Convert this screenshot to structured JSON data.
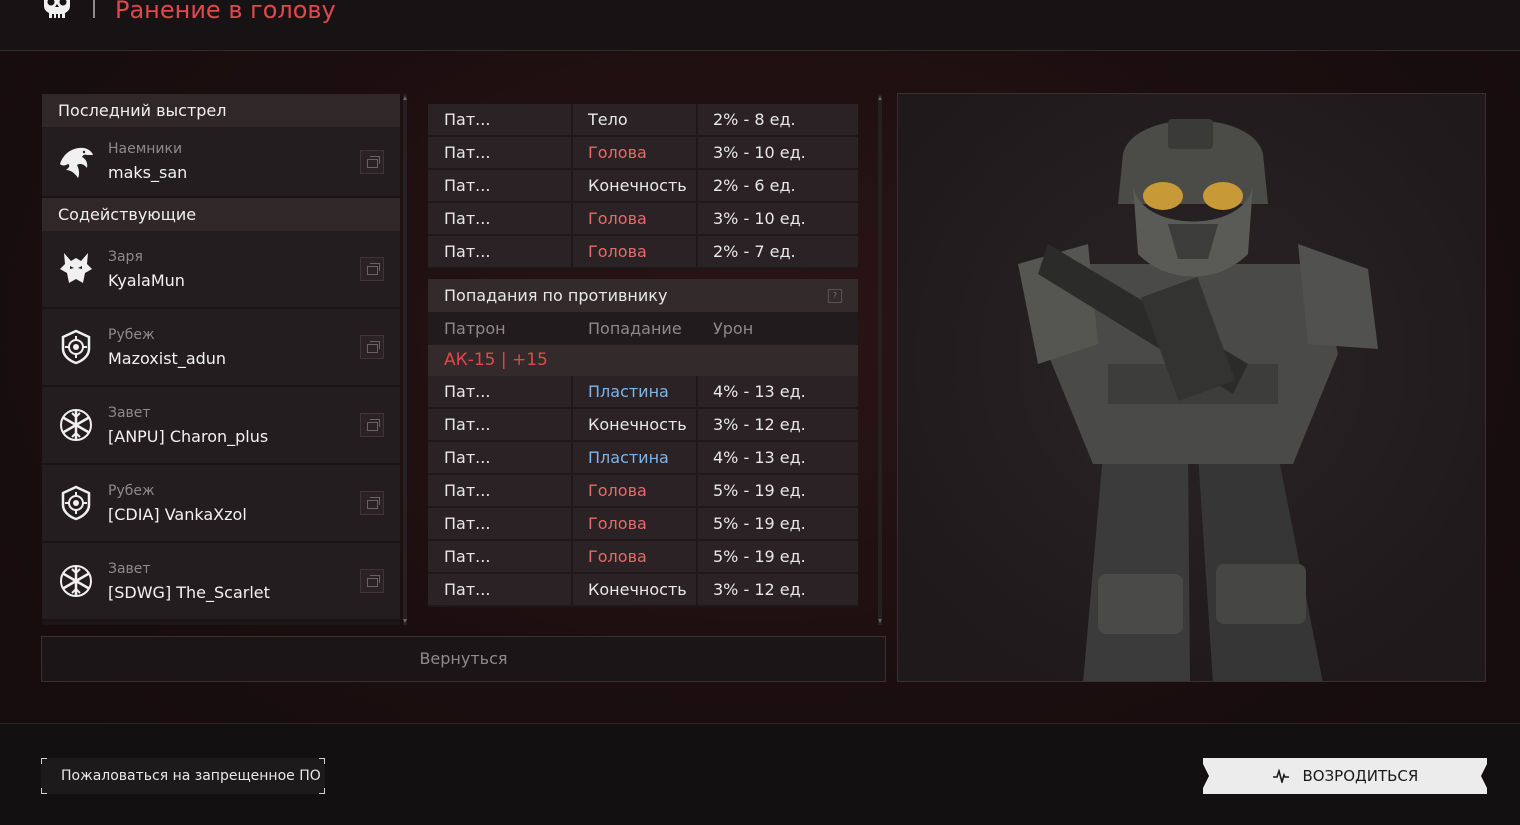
{
  "header": {
    "title": "Ранение в голову",
    "skull_icon": "skull-icon"
  },
  "colors": {
    "accent_red": "#e2474b",
    "blue_text": "#7db6ea",
    "red_text": "#e56b6b"
  },
  "killer_panel": {
    "last_shot_title": "Последний выстрел",
    "killer": {
      "faction": "Наемники",
      "name": "maks_san",
      "icon": "eagle-icon"
    },
    "assist_title": "Содействующие",
    "assists": [
      {
        "faction": "Заря",
        "name": "KyalaMun",
        "icon": "wolf-icon"
      },
      {
        "faction": "Рубеж",
        "name": "Mazoxist_adun",
        "icon": "shield-target-icon"
      },
      {
        "faction": "Завет",
        "name": "[ANPU] Charon_plus",
        "icon": "snowflake-emblem-icon"
      },
      {
        "faction": "Рубеж",
        "name": "[CDIA] VankaXzol",
        "icon": "shield-target-icon"
      },
      {
        "faction": "Завет",
        "name": "[SDWG] The_Scarlet",
        "icon": "snowflake-emblem-icon"
      }
    ]
  },
  "damage_taken": {
    "rows": [
      {
        "ammo": "Пат...",
        "hit": "Тело",
        "hit_color": "white",
        "damage": "2% - 8 ед."
      },
      {
        "ammo": "Пат...",
        "hit": "Голова",
        "hit_color": "red",
        "damage": "3% - 10 ед."
      },
      {
        "ammo": "Пат...",
        "hit": "Конечность",
        "hit_color": "white",
        "damage": "2% - 6 ед."
      },
      {
        "ammo": "Пат...",
        "hit": "Голова",
        "hit_color": "red",
        "damage": "3% - 10 ед."
      },
      {
        "ammo": "Пат...",
        "hit": "Голова",
        "hit_color": "red",
        "damage": "2% - 7 ед."
      }
    ]
  },
  "hits_on_enemy": {
    "title": "Попадания по противнику",
    "help": "?",
    "columns": [
      "Патрон",
      "Попадание",
      "Урон"
    ],
    "weapon": "АК-15 | +15",
    "rows": [
      {
        "ammo": "Пат...",
        "hit": "Пластина",
        "hit_color": "blue",
        "damage": "4% - 13 ед."
      },
      {
        "ammo": "Пат...",
        "hit": "Конечность",
        "hit_color": "white",
        "damage": "3% - 12 ед."
      },
      {
        "ammo": "Пат...",
        "hit": "Пластина",
        "hit_color": "blue",
        "damage": "4% - 13 ед."
      },
      {
        "ammo": "Пат...",
        "hit": "Голова",
        "hit_color": "red",
        "damage": "5% - 19 ед."
      },
      {
        "ammo": "Пат...",
        "hit": "Голова",
        "hit_color": "red",
        "damage": "5% - 19 ед."
      },
      {
        "ammo": "Пат...",
        "hit": "Голова",
        "hit_color": "red",
        "damage": "5% - 19 ед."
      },
      {
        "ammo": "Пат...",
        "hit": "Конечность",
        "hit_color": "white",
        "damage": "3% - 12 ед."
      }
    ]
  },
  "buttons": {
    "back": "Вернуться",
    "report": "Пожаловаться на запрещенное ПО",
    "respawn": "ВОЗРОДИТЬСЯ",
    "respawn_icon": "pulse-icon"
  }
}
